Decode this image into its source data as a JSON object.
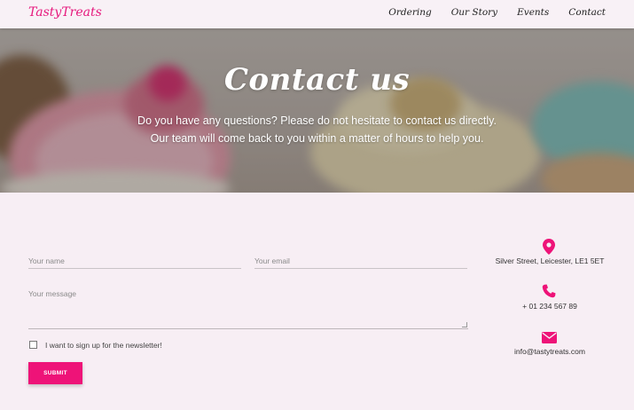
{
  "brand": {
    "name": "TastyTreats"
  },
  "nav": {
    "items": [
      {
        "label": "Ordering"
      },
      {
        "label": "Our Story"
      },
      {
        "label": "Events"
      },
      {
        "label": "Contact"
      }
    ]
  },
  "hero": {
    "title": "Contact us",
    "subtitle_line1": "Do you have any questions? Please do not hesitate to contact us directly.",
    "subtitle_line2": "Our team will come back to you within a matter of hours to help you."
  },
  "form": {
    "name_placeholder": "Your name",
    "email_placeholder": "Your email",
    "message_placeholder": "Your message",
    "newsletter_label": "I want to sign up for the newsletter!",
    "newsletter_checked": false,
    "submit_label": "SUBMIT"
  },
  "contact": {
    "address": "Silver Street, Leicester, LE1 5ET",
    "address_icon": "map-marker-icon",
    "phone": "+ 01 234 567 89",
    "phone_icon": "phone-icon",
    "email": "info@tastytreats.com",
    "email_icon": "envelope-icon"
  },
  "colors": {
    "accent": "#ee1378",
    "background": "#f7eef4",
    "brand_text": "#e6197d"
  }
}
